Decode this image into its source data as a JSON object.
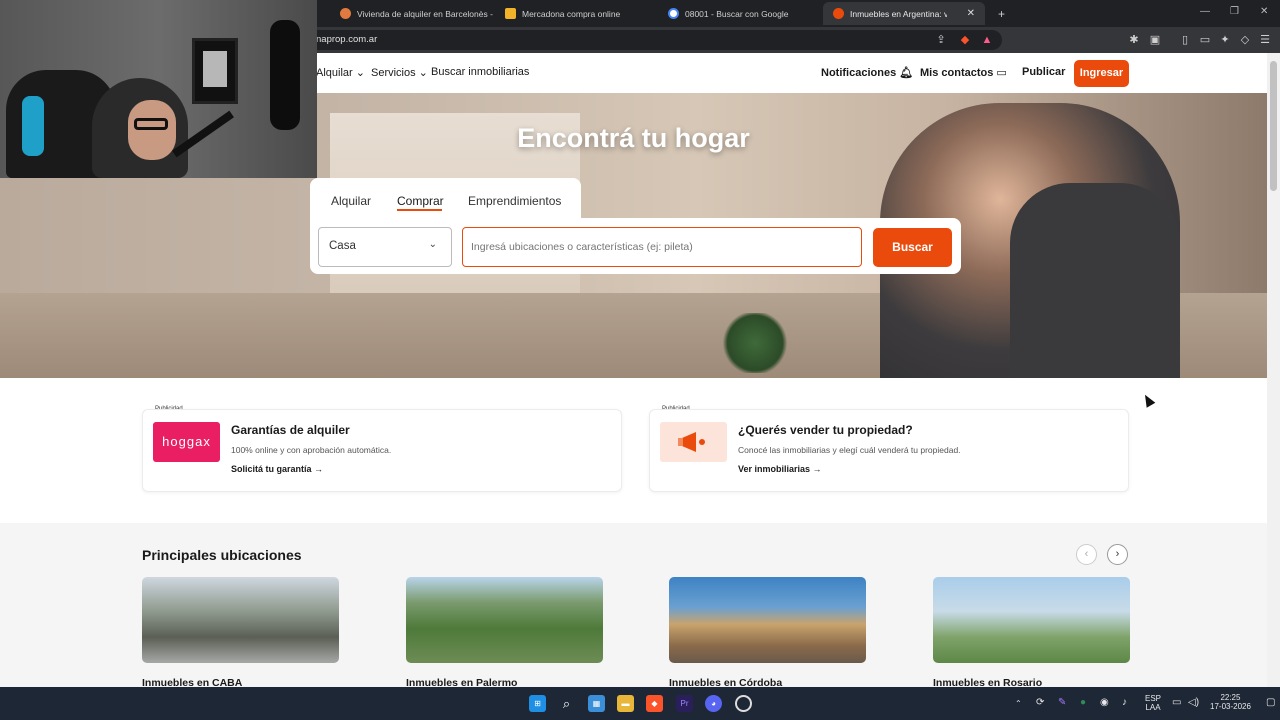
{
  "browser": {
    "tabs": [
      {
        "label": "Vivienda de alquiler en Barcelonès -",
        "fav_color": "#e07a3f"
      },
      {
        "label": "Mercadona compra online",
        "fav_color": "#f2b32a"
      },
      {
        "label": "08001 - Buscar con Google",
        "fav_color": "#4285f4"
      },
      {
        "label": "Inmuebles en Argentina: venta y",
        "fav_color": "#ea4b0c",
        "active": true
      }
    ],
    "url": "naprop.com.ar"
  },
  "site": {
    "nav": {
      "alquilar": "Alquilar",
      "servicios": "Servicios",
      "buscar_inmobiliarias": "Buscar inmobiliarias",
      "notificaciones": "Notificaciones",
      "mis_contactos": "Mis contactos",
      "publicar": "Publicar",
      "ingresar": "Ingresar"
    },
    "hero": {
      "title": "Encontrá tu hogar",
      "tabs": [
        "Alquilar",
        "Comprar",
        "Emprendimientos"
      ],
      "active_tab": "Comprar",
      "property_type": "Casa",
      "search_placeholder": "Ingresá ubicaciones o características (ej: pileta)",
      "search_button": "Buscar"
    },
    "ads": [
      {
        "tag": "Publicidad",
        "logo_text": "hoggax",
        "title": "Garantías de alquiler",
        "desc": "100% online y con aprobación automática.",
        "link": "Solicitá tu garantía"
      },
      {
        "tag": "Publicidad",
        "title": "¿Querés vender tu propiedad?",
        "desc": "Conocé las inmobiliarias y elegí cuál venderá tu propiedad.",
        "link": "Ver inmobiliarias"
      }
    ],
    "locations": {
      "title": "Principales ubicaciones",
      "items": [
        "Inmuebles en CABA",
        "Inmuebles en Palermo",
        "Inmuebles en Córdoba",
        "Inmuebles en Rosario"
      ]
    }
  },
  "taskbar": {
    "lang": "ESP",
    "lang2": "LAA",
    "time": "22:25",
    "date": "17-03-2026"
  },
  "colors": {
    "brand": "#ea4b0c",
    "hoggax": "#e91e63"
  }
}
